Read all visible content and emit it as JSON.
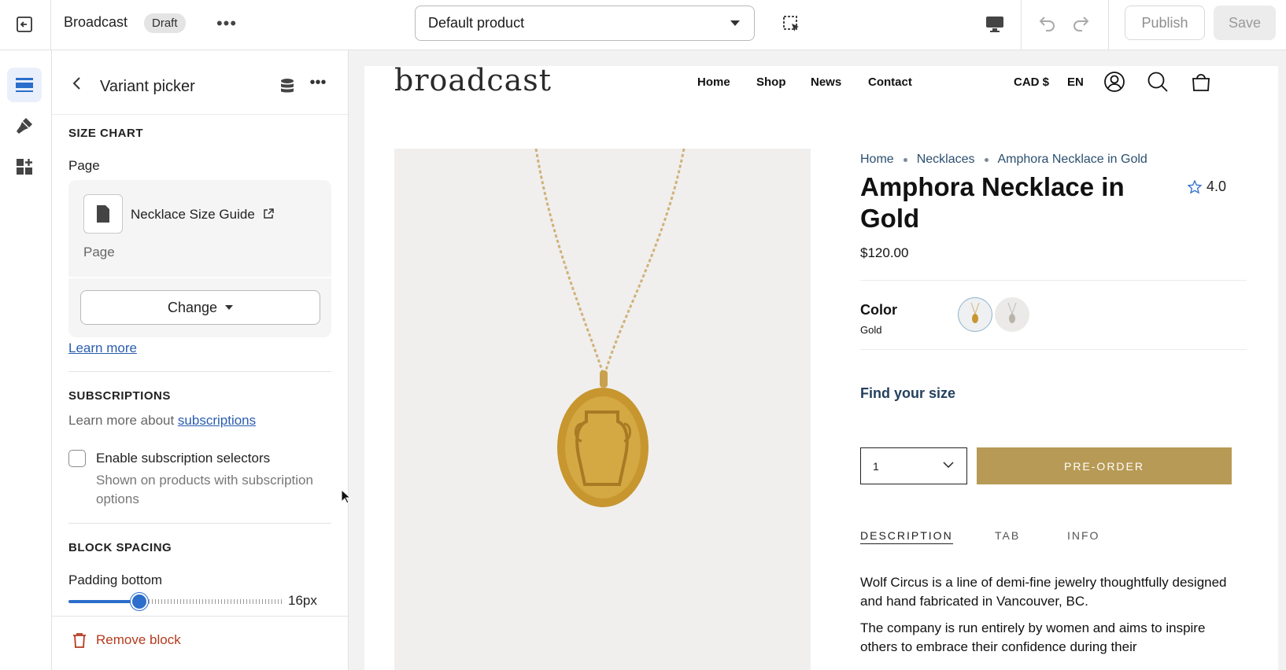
{
  "topbar": {
    "theme_name": "Broadcast",
    "status_badge": "Draft",
    "template_select": "Default product",
    "publish_label": "Publish",
    "save_label": "Save"
  },
  "rail": {
    "items": [
      "sections-icon",
      "theme-settings-icon",
      "app-blocks-icon"
    ]
  },
  "panel": {
    "title": "Variant picker",
    "size_chart": {
      "heading": "SIZE CHART",
      "field_label": "Page",
      "page_name": "Necklace Size Guide",
      "page_type": "Page",
      "change_label": "Change",
      "learn_more": "Learn more"
    },
    "subscriptions": {
      "heading": "SUBSCRIPTIONS",
      "help_prefix": "Learn more about ",
      "help_link": "subscriptions",
      "checkbox_label": "Enable subscription selectors",
      "checkbox_help": "Shown on products with subscription options",
      "checked": false
    },
    "block_spacing": {
      "heading": "BLOCK SPACING",
      "padding_label": "Padding bottom",
      "padding_value": "16px",
      "slider_fraction": 0.33
    },
    "remove_label": "Remove block"
  },
  "store": {
    "logo": "broadcast",
    "nav": [
      "Home",
      "Shop",
      "News",
      "Contact"
    ],
    "currency": "CAD $",
    "language": "EN",
    "breadcrumbs": [
      "Home",
      "Necklaces",
      "Amphora Necklace in Gold"
    ],
    "product_title": "Amphora Necklace in Gold",
    "rating": "4.0",
    "price": "$120.00",
    "color_label": "Color",
    "color_value": "Gold",
    "find_size": "Find your size",
    "quantity": "1",
    "preorder": "PRE-ORDER",
    "tabs": [
      "DESCRIPTION",
      "TAB",
      "INFO"
    ],
    "description": [
      "Wolf Circus is a line of demi-fine jewelry thoughtfully designed and hand fabricated in Vancouver, BC.",
      "The company is run entirely by women and aims to inspire others to embrace their confidence during their"
    ],
    "colors": {
      "accent": "#2c6ecb",
      "preorder": "#b79a55",
      "crumb": "#2b4f6e"
    }
  }
}
